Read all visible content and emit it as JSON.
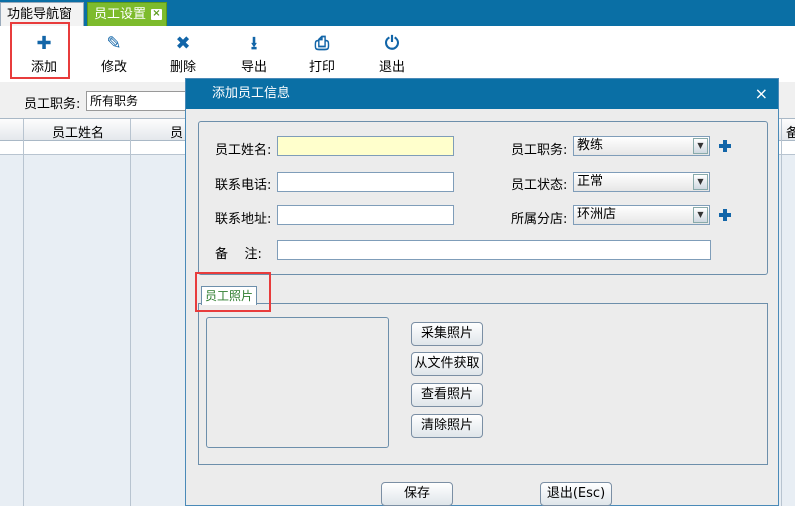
{
  "tabs": [
    {
      "label": "功能导航窗口"
    },
    {
      "label": "员工设置",
      "close": "×"
    }
  ],
  "toolbar": {
    "add": {
      "icon": "plus-icon",
      "glyph": "✚",
      "label": "添加"
    },
    "edit": {
      "icon": "pencil-icon",
      "glyph": "✎",
      "label": "修改"
    },
    "delete": {
      "icon": "x-icon",
      "glyph": "✖",
      "label": "删除"
    },
    "export": {
      "icon": "download-icon",
      "glyph": "⭳",
      "label": "导出"
    },
    "print": {
      "icon": "printer-icon",
      "glyph": "⎙",
      "label": "打印"
    },
    "exit": {
      "icon": "power-icon",
      "glyph": "⏻",
      "label": "退出"
    }
  },
  "filter": {
    "label": "员工职务:",
    "value": "所有职务"
  },
  "grid": {
    "columns": [
      "员工姓名",
      "员",
      "备"
    ]
  },
  "dialog": {
    "title": "添加员工信息",
    "close": "×",
    "fields": {
      "name_label": "员工姓名:",
      "name_value": "",
      "phone_label": "联系电话:",
      "phone_value": "",
      "address_label": "联系地址:",
      "address_value": "",
      "remark_label": "备    注:",
      "remark_value": "",
      "position_label": "员工职务:",
      "position_value": "教练",
      "status_label": "员工状态:",
      "status_value": "正常",
      "branch_label": "所属分店:",
      "branch_value": "环洲店"
    },
    "photo_tab": "员工照片",
    "photo_buttons": [
      "采集照片",
      "从文件获取",
      "查看照片",
      "清除照片"
    ],
    "save": "保存",
    "exit": "退出(Esc)"
  },
  "colors": {
    "titlebar": "#0a6fa5",
    "active_tab": "#7dbb2c",
    "icon_blue": "#1265a8",
    "highlight": "#e83c3c",
    "name_field": "#ffffcc"
  }
}
